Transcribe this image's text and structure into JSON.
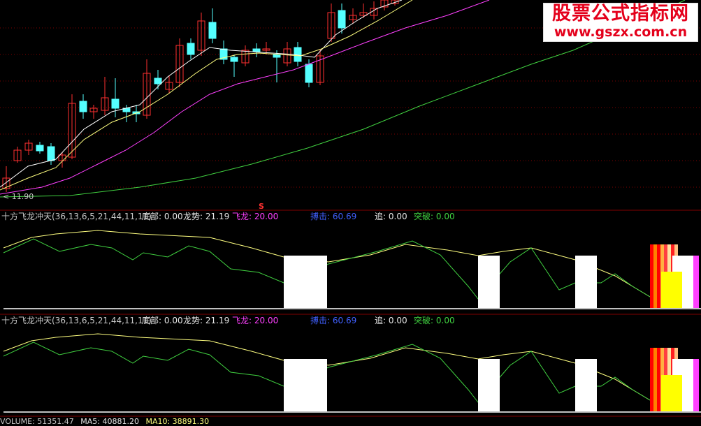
{
  "main_chart": {
    "last_price_label": "11.90",
    "marker_label": "S"
  },
  "indicator_panels": [
    {
      "name": "十方飞龙冲天(36,13,6,5,21,44,11,11)",
      "fields": [
        {
          "label": "底部:",
          "value": "0.00",
          "color": "#e6e6e6"
        },
        {
          "label": "龙势:",
          "value": "21.19",
          "color": "#e6e6e6"
        },
        {
          "label": "飞龙:",
          "value": "20.00",
          "color": "#ff40ff"
        },
        {
          "label": "搏击:",
          "value": "60.69",
          "color": "#4060ff"
        },
        {
          "label": "追:",
          "value": "0.00",
          "color": "#e6e6e6"
        },
        {
          "label": "突破:",
          "value": "0.00",
          "color": "#40d040"
        }
      ]
    },
    {
      "name": "十方飞龙冲天(36,13,6,5,21,44,11,11)",
      "fields": [
        {
          "label": "底部:",
          "value": "0.00",
          "color": "#e6e6e6"
        },
        {
          "label": "龙势:",
          "value": "21.19",
          "color": "#e6e6e6"
        },
        {
          "label": "飞龙:",
          "value": "20.00",
          "color": "#ff40ff"
        },
        {
          "label": "搏击:",
          "value": "60.69",
          "color": "#4060ff"
        },
        {
          "label": "追:",
          "value": "0.00",
          "color": "#e6e6e6"
        },
        {
          "label": "突破:",
          "value": "0.00",
          "color": "#40d040"
        }
      ]
    }
  ],
  "footer": {
    "volume": "VOLUME: 51351.47",
    "ma5": "MA5: 40881.20",
    "ma10": "MA10: 38891.30"
  },
  "watermark": {
    "title": "股票公式指标网",
    "url": "www.gszx.com.cn"
  },
  "colors": {
    "up": "#ff3030",
    "down": "#54ffff",
    "ma_short": "#ffffff",
    "ma_mid": "#ffff80",
    "ma_long": "#ff40ff",
    "ma_xlong": "#40d040",
    "grid": "#800000"
  }
}
